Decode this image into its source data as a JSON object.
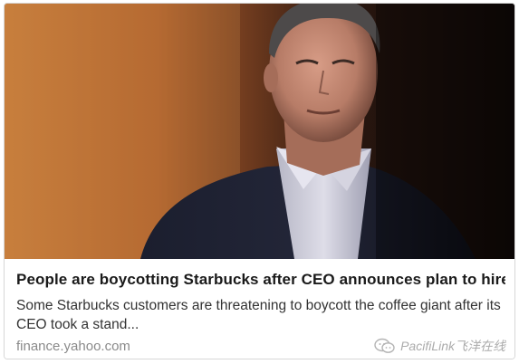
{
  "card": {
    "headline": "People are boycotting Starbucks after CEO announces plan to hire th...",
    "snippet": "Some Starbucks customers are threatening to boycott the coffee giant after its CEO took a stand...",
    "source": "finance.yahoo.com"
  },
  "watermark": {
    "text": "PacifiLink飞洋在线",
    "icon": "wechat-icon"
  },
  "colors": {
    "headline": "#1a1a1a",
    "snippet": "#333333",
    "source": "#8a8a8a",
    "card_border": "#d7d7d7"
  }
}
